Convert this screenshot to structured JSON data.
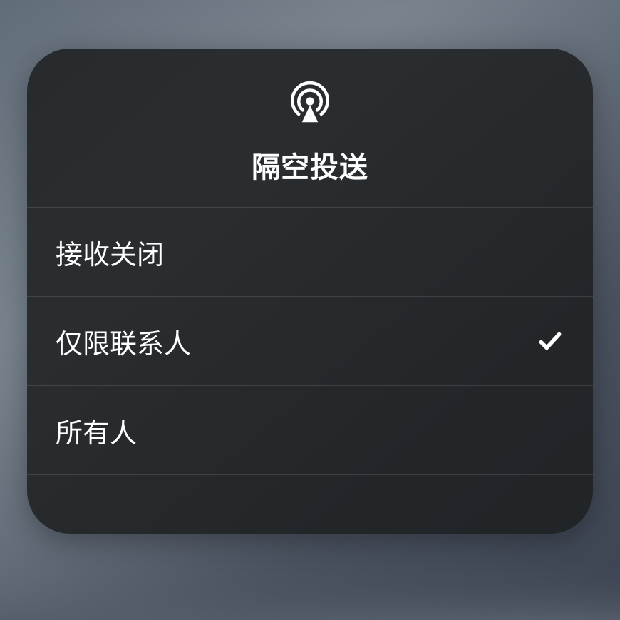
{
  "header": {
    "title": "隔空投送"
  },
  "options": [
    {
      "label": "接收关闭",
      "selected": false
    },
    {
      "label": "仅限联系人",
      "selected": true
    },
    {
      "label": "所有人",
      "selected": false
    }
  ]
}
